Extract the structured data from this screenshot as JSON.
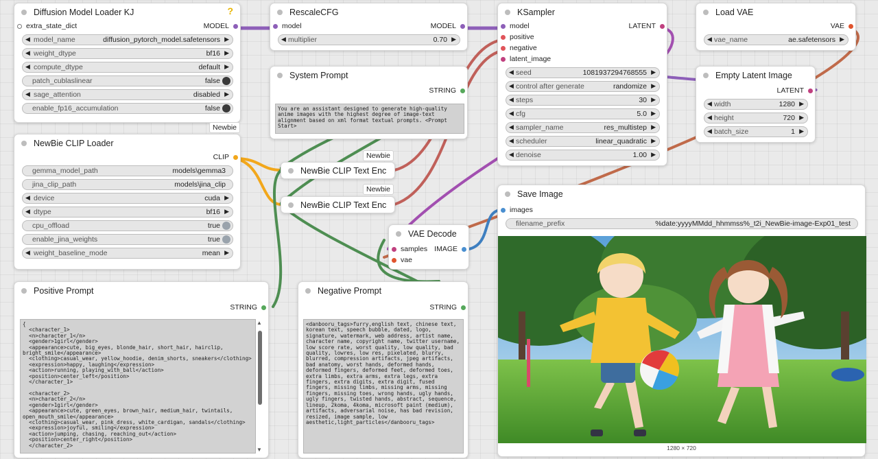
{
  "colors": {
    "model": "#8d5fb8",
    "clip": "#f2a71b",
    "conditioning": "#d9a13a",
    "latent": "#c0407f",
    "vae": "#e0542e",
    "image": "#4a8fd0",
    "string": "#56a85b",
    "float": "#888888"
  },
  "loader": {
    "title": "Diffusion Model Loader KJ",
    "help_icon": "question-mark-icon",
    "input_label": "extra_state_dict",
    "output_label": "MODEL",
    "model_name_label": "model_name",
    "model_name_value": "diffusion_pytorch_model.safetensors",
    "weight_dtype_label": "weight_dtype",
    "weight_dtype_value": "bf16",
    "compute_dtype_label": "compute_dtype",
    "compute_dtype_value": "default",
    "patch_cublaslinear_label": "patch_cublaslinear",
    "patch_cublaslinear_value": "false",
    "sage_attention_label": "sage_attention",
    "sage_attention_value": "disabled",
    "enable_fp16_label": "enable_fp16_accumulation",
    "enable_fp16_value": "false"
  },
  "rescale": {
    "title": "RescaleCFG",
    "input_label": "model",
    "output_label": "MODEL",
    "multiplier_label": "multiplier",
    "multiplier_value": "0.70"
  },
  "system_prompt": {
    "title": "System Prompt",
    "output_label": "STRING",
    "text": "You are an assistant designed to generate high-quality anime images with the highest degree of image-text alignment based on xml format textual prompts. <Prompt Start>"
  },
  "badges": {
    "loader_badge": "Newbie",
    "enc1_badge": "Newbie",
    "enc2_badge": "Newbie"
  },
  "clip_loader": {
    "title": "NewBie CLIP Loader",
    "output_label": "CLIP",
    "gemma_label": "gemma_model_path",
    "gemma_value": "models\\gemma3",
    "jina_label": "jina_clip_path",
    "jina_value": "models\\jina_clip",
    "device_label": "device",
    "device_value": "cuda",
    "dtype_label": "dtype",
    "dtype_value": "bf16",
    "cpu_offload_label": "cpu_offload",
    "cpu_offload_value": "true",
    "enable_jina_label": "enable_jina_weights",
    "enable_jina_value": "true",
    "weight_baseline_label": "weight_baseline_mode",
    "weight_baseline_value": "mean"
  },
  "encoder1": {
    "title": "NewBie CLIP Text Enc"
  },
  "encoder2": {
    "title": "NewBie CLIP Text Enc"
  },
  "positive_prompt": {
    "title": "Positive Prompt",
    "output_label": "STRING",
    "text": "{\n  <character_1>\n  <n>character_1</n>\n  <gender>1girl</gender>\n  <appearance>cute, big_eyes, blonde_hair, short_hair, hairclip, bright_smile</appearance>\n  <clothing>casual_wear, yellow_hoodie, denim_shorts, sneakers</clothing>\n  <expression>happy, laughing</expression>\n  <action>running, playing_with_ball</action>\n  <position>center_left</position>\n  </character_1>\n\n  <character_2>\n  <n>character_2</n>\n  <gender>1girl</gender>\n  <appearance>cute, green_eyes, brown_hair, medium_hair, twintails, open_mouth_smile</appearance>\n  <clothing>casual_wear, pink_dress, white_cardigan, sandals</clothing>\n  <expression>joyful, smiling</expression>\n  <action>jumping, chasing, reaching_out</action>\n  <position>center_right</position>\n  </character_2>"
  },
  "negative_prompt": {
    "title": "Negative Prompt",
    "output_label": "STRING",
    "text": "<danbooru_tags>furry,english text, chinese text, korean text, speech bubble, dated, logo, signature, watermark, web address, artist name, character name, copyright name, twitter username, low score rate, worst quality, low quality, bad quality, lowres, low res, pixelated, blurry, blurred, compression artifacts, jpeg artifacts, bad anatomy, worst hands, deformed hands, deformed fingers, deformed feet, deformed toes, extra limbs, extra arms, extra legs, extra fingers, extra digits, extra digit, fused fingers, missing limbs, missing arms, missing fingers, missing toes, wrong hands, ugly hands, ugly fingers, twisted hands, abstract, sequence, lineup, 2koma, 4koma, microsoft paint (medium), artifacts, adversarial noise, has bad revision, resized, image sample, low aesthetic,light_particles</danbooru_tags>"
  },
  "vae_decode": {
    "title": "VAE Decode",
    "samples_label": "samples",
    "vae_label": "vae",
    "output_label": "IMAGE"
  },
  "ksampler": {
    "title": "KSampler",
    "inputs": [
      "model",
      "positive",
      "negative",
      "latent_image"
    ],
    "output_label": "LATENT",
    "seed_label": "seed",
    "seed_value": "1081937294768555",
    "control_label": "control after generate",
    "control_value": "randomize",
    "steps_label": "steps",
    "steps_value": "30",
    "cfg_label": "cfg",
    "cfg_value": "5.0",
    "sampler_label": "sampler_name",
    "sampler_value": "res_multistep",
    "scheduler_label": "scheduler",
    "scheduler_value": "linear_quadratic",
    "denoise_label": "denoise",
    "denoise_value": "1.00"
  },
  "load_vae": {
    "title": "Load VAE",
    "output_label": "VAE",
    "vae_name_label": "vae_name",
    "vae_name_value": "ae.safetensors"
  },
  "empty_latent": {
    "title": "Empty Latent Image",
    "output_label": "LATENT",
    "width_label": "width",
    "width_value": "1280",
    "height_label": "height",
    "height_value": "720",
    "batch_label": "batch_size",
    "batch_value": "1"
  },
  "save_image": {
    "title": "Save Image",
    "input_label": "images",
    "prefix_label": "filename_prefix",
    "prefix_value": "%date:yyyyMMdd_hhmmss%_t2i_NewBie-image-Exp01_test",
    "dimensions": "1280 × 720"
  }
}
